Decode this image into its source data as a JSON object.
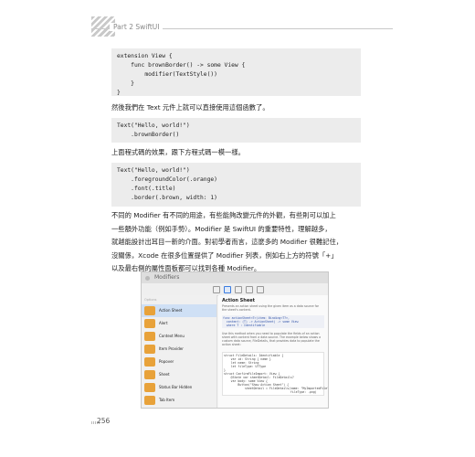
{
  "header": {
    "text": "Part 2 SwiftUI"
  },
  "code1": [
    "extension View {",
    "    func brownBorder() -> some View {",
    "        modifier(TextStyle())",
    "    }",
    "}"
  ],
  "para1": "然後我們在 Text 元件上就可以直接使用這個函數了。",
  "code2": [
    "Text(\"Hello, world!\")",
    "    .brownBorder()"
  ],
  "para2": "上面程式碼的效果，跟下方程式碼一模一樣。",
  "code3": [
    "Text(\"Hello, world!\")",
    "    .foregroundColor(.orange)",
    "    .font(.title)",
    "    .border(.brown, width: 1)"
  ],
  "para3": [
    "不同的 Modifier 有不同的用途，有些能夠改變元件的外觀，有些則可以加上",
    "一些額外功能（例如手勢）。Modifier 是 SwiftUI 的重要特性，理解越多，",
    "就越能設計出耳目一新的介面。對初學者而言，這麼多的 Modifier 很難記住，",
    "沒關係，Xcode 在很多位置提供了 Modifier 列表，例如右上方的符號「+」",
    "以及最右側的屬性面板都可以找到各種 Modifier。"
  ],
  "figure": {
    "window_title": "Modifiers",
    "search": "Options",
    "items": [
      "Action Sheet",
      "Alert",
      "Context Menu",
      "Item Provider",
      "Popover",
      "Sheet",
      "Status Bar Hidden",
      "Tab Item"
    ],
    "selected": "Action Sheet",
    "accent_color": "#e8a23a",
    "detail_title": "Action Sheet",
    "detail_desc": "Presents an action sheet using the given item as a data source for the sheet's content.",
    "detail_sig": [
      "func actionSheet<T>(item: Binding<T?>,",
      "  content: (T) -> ActionSheet) -> some View",
      "  where T : Identifiable"
    ],
    "detail_desc2": "Use this method when you need to populate the fields of an action sheet with content from a data source. The example below shows a custom data source, FileDetails, that provides data to populate the action sheet:",
    "detail_code": [
      "struct FileDetails: Identifiable {",
      "    var id: String { name }",
      "    let name: String",
      "    let fileType: UTType",
      "}",
      "struct ConfirmFileImport: View {",
      "    @State var sheetDetail: FileDetails?",
      "    var body: some View {",
      "        Button(\"Show Action Sheet\") {",
      "            sheetDetail = FileDetails(name: \"MyImportedFile\",",
      "                                      fileType: .png)"
    ]
  },
  "page_number": "256"
}
